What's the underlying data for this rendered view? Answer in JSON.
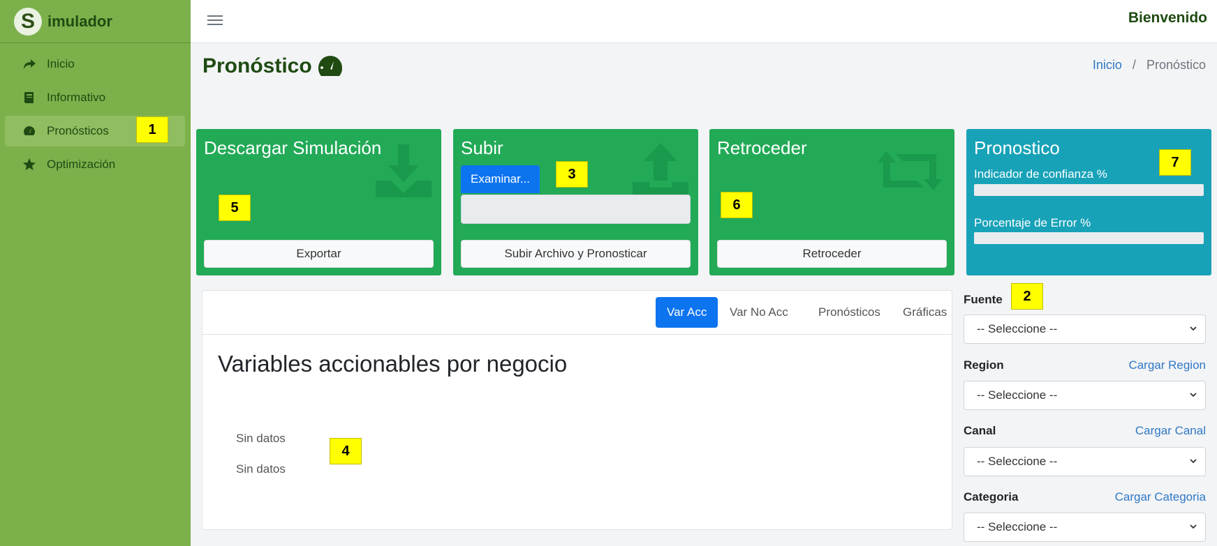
{
  "brand": {
    "logo_letter": "S",
    "name": "imulador"
  },
  "sidebar": {
    "items": [
      {
        "label": "Inicio",
        "icon": "share-arrow-icon"
      },
      {
        "label": "Informativo",
        "icon": "book-icon"
      },
      {
        "label": "Pronósticos",
        "icon": "gauge-icon",
        "active": true
      },
      {
        "label": "Optimización",
        "icon": "star-icon"
      }
    ]
  },
  "topbar": {
    "welcome": "Bienvenido"
  },
  "page": {
    "title": "Pronóstico",
    "title_icon": "gauge-icon"
  },
  "breadcrumb": {
    "home": "Inicio",
    "separator": "/",
    "current": "Pronóstico"
  },
  "cards": {
    "download": {
      "title": "Descargar Simulación",
      "button": "Exportar",
      "icon": "download-icon"
    },
    "upload": {
      "title": "Subir",
      "browse": "Examinar...",
      "button": "Subir Archivo y Pronosticar",
      "icon": "upload-icon"
    },
    "back": {
      "title": "Retroceder",
      "button": "Retroceder",
      "icon": "retweet-icon"
    },
    "forecast": {
      "title": "Pronostico",
      "confidence_label": "Indicador de confianza %",
      "confidence_value": 0,
      "error_label": "Porcentaje de Error %",
      "error_value": 0
    }
  },
  "tabs": [
    "Var Acc",
    "Var No Acc",
    "Pronósticos",
    "Gráficas"
  ],
  "panel": {
    "heading": "Variables accionables por negocio",
    "nodata_1": "Sin datos",
    "nodata_2": "Sin datos"
  },
  "filters": {
    "fuente": {
      "label": "Fuente",
      "value": "-- Seleccione --"
    },
    "region": {
      "label": "Region",
      "link": "Cargar Region",
      "value": "-- Seleccione --"
    },
    "canal": {
      "label": "Canal",
      "link": "Cargar Canal",
      "value": "-- Seleccione --"
    },
    "categoria": {
      "label": "Categoria",
      "link": "Cargar Categoria",
      "value": "-- Seleccione --"
    }
  },
  "markers": [
    "1",
    "2",
    "3",
    "4",
    "5",
    "6",
    "7"
  ],
  "colors": {
    "sidebar": "#7cb04b",
    "card_green": "#22aa57",
    "card_teal": "#17a2b8",
    "primary": "#0d74f0",
    "brand_text": "#1f4b12"
  }
}
